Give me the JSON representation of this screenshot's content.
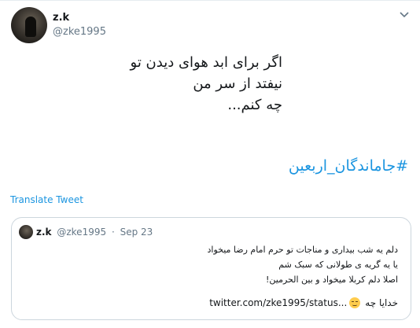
{
  "tweet": {
    "author_name": "z.k",
    "author_handle": "@zke1995",
    "text": "اگر برای ابد هوای دیدن تو\nنیفتد از سر من\nچه کنم...",
    "hashtag": "#جاماندگان_اربعین",
    "translate_label": "Translate Tweet",
    "avatar_icon": "avatar-photo-icon",
    "menu_icon": "chevron-down-icon"
  },
  "quote": {
    "author_name": "z.k",
    "author_handle": "@zke1995",
    "separator": "·",
    "date": "Sep 23",
    "text": "دلم یه شب بیداری و مناجات تو حرم امام رضا میخواد\nیا یه گریه ی طولانی که سبک شم\nاصلا دلم کربلا میخواد و بین الحرمین!",
    "last_line_text": "خدایا چه",
    "emoji_icon": "pensive-face-emoji",
    "link": "twitter.com/zke1995/status..."
  },
  "colors": {
    "link": "#1b95e0",
    "secondary_text": "#657786",
    "border": "#ccd6dd"
  }
}
